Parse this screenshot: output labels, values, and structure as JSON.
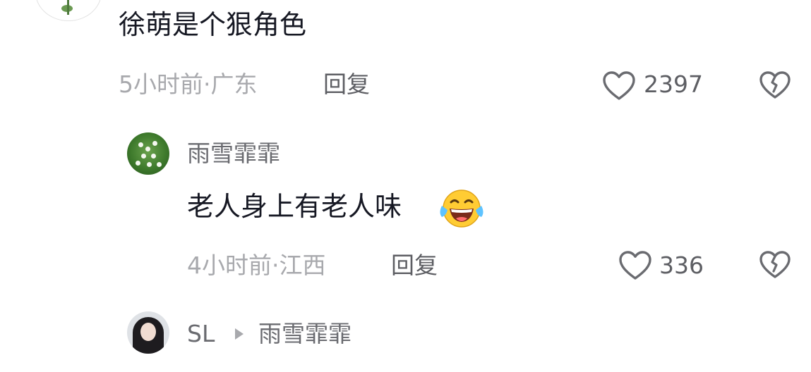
{
  "top_comment": {
    "text": "徐萌是个狠角色",
    "meta": "5小时前·广东",
    "reply_label": "回复",
    "like_count": "2397"
  },
  "reply_1": {
    "username": "雨雪霏霏",
    "text": "老人身上有老人味",
    "emoji": "laughing-crying-emoji",
    "meta": "4小时前·江西",
    "reply_label": "回复",
    "like_count": "336"
  },
  "reply_2": {
    "username": "SL",
    "reply_to": "雨雪霏霏"
  },
  "colors": {
    "text_primary": "#161823",
    "text_meta": "#a8a9ad",
    "text_secondary": "#5d5e63",
    "icon": "#6a6b70"
  }
}
